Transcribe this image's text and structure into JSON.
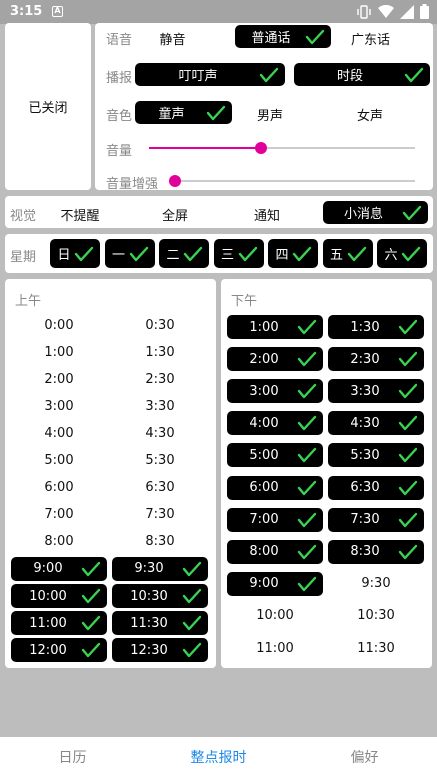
{
  "status": {
    "time": "3:15",
    "notif_letter": "A"
  },
  "voice": {
    "closed_label": "已关闭",
    "speech_label": "语音",
    "speech_options": [
      {
        "label": "静音",
        "selected": false
      },
      {
        "label": "普通话",
        "selected": true
      },
      {
        "label": "广东话",
        "selected": false
      }
    ],
    "broadcast_label": "播报",
    "broadcast_options": [
      {
        "label": "叮叮声",
        "selected": true
      },
      {
        "label": "时段",
        "selected": true
      }
    ],
    "timbre_label": "音色",
    "timbre_options": [
      {
        "label": "童声",
        "selected": true
      },
      {
        "label": "男声",
        "selected": false
      },
      {
        "label": "女声",
        "selected": false
      }
    ],
    "volume_label": "音量",
    "volume_value": 0.42,
    "boost_label": "音量增强",
    "boost_value": 0.0
  },
  "visual": {
    "label": "视觉",
    "options": [
      {
        "label": "不提醒",
        "selected": false
      },
      {
        "label": "全屏",
        "selected": false
      },
      {
        "label": "通知",
        "selected": false
      },
      {
        "label": "小消息",
        "selected": true
      }
    ]
  },
  "week": {
    "label": "星期",
    "days": [
      {
        "label": "日",
        "selected": true
      },
      {
        "label": "一",
        "selected": true
      },
      {
        "label": "二",
        "selected": true
      },
      {
        "label": "三",
        "selected": true
      },
      {
        "label": "四",
        "selected": true
      },
      {
        "label": "五",
        "selected": true
      },
      {
        "label": "六",
        "selected": true
      }
    ]
  },
  "am": {
    "title": "上午",
    "slots": [
      {
        "t": "0:00",
        "on": false
      },
      {
        "t": "0:30",
        "on": false
      },
      {
        "t": "1:00",
        "on": false
      },
      {
        "t": "1:30",
        "on": false
      },
      {
        "t": "2:00",
        "on": false
      },
      {
        "t": "2:30",
        "on": false
      },
      {
        "t": "3:00",
        "on": false
      },
      {
        "t": "3:30",
        "on": false
      },
      {
        "t": "4:00",
        "on": false
      },
      {
        "t": "4:30",
        "on": false
      },
      {
        "t": "5:00",
        "on": false
      },
      {
        "t": "5:30",
        "on": false
      },
      {
        "t": "6:00",
        "on": false
      },
      {
        "t": "6:30",
        "on": false
      },
      {
        "t": "7:00",
        "on": false
      },
      {
        "t": "7:30",
        "on": false
      },
      {
        "t": "8:00",
        "on": false
      },
      {
        "t": "8:30",
        "on": false
      },
      {
        "t": "9:00",
        "on": true
      },
      {
        "t": "9:30",
        "on": true
      },
      {
        "t": "10:00",
        "on": true
      },
      {
        "t": "10:30",
        "on": true
      },
      {
        "t": "11:00",
        "on": true
      },
      {
        "t": "11:30",
        "on": true
      },
      {
        "t": "12:00",
        "on": true
      },
      {
        "t": "12:30",
        "on": true
      }
    ]
  },
  "pm": {
    "title": "下午",
    "slots": [
      {
        "t": "1:00",
        "on": true
      },
      {
        "t": "1:30",
        "on": true
      },
      {
        "t": "2:00",
        "on": true
      },
      {
        "t": "2:30",
        "on": true
      },
      {
        "t": "3:00",
        "on": true
      },
      {
        "t": "3:30",
        "on": true
      },
      {
        "t": "4:00",
        "on": true
      },
      {
        "t": "4:30",
        "on": true
      },
      {
        "t": "5:00",
        "on": true
      },
      {
        "t": "5:30",
        "on": true
      },
      {
        "t": "6:00",
        "on": true
      },
      {
        "t": "6:30",
        "on": true
      },
      {
        "t": "7:00",
        "on": true
      },
      {
        "t": "7:30",
        "on": true
      },
      {
        "t": "8:00",
        "on": true
      },
      {
        "t": "8:30",
        "on": true
      },
      {
        "t": "9:00",
        "on": true
      },
      {
        "t": "9:30",
        "on": false
      },
      {
        "t": "10:00",
        "on": false
      },
      {
        "t": "10:30",
        "on": false
      },
      {
        "t": "11:00",
        "on": false
      },
      {
        "t": "11:30",
        "on": false
      }
    ]
  },
  "nav": {
    "tabs": [
      {
        "label": "日历",
        "active": false
      },
      {
        "label": "整点报时",
        "active": true
      },
      {
        "label": "偏好",
        "active": false
      }
    ]
  },
  "colors": {
    "accent": "#e0009a",
    "check": "#39d353",
    "active_tab": "#1e88e5"
  }
}
